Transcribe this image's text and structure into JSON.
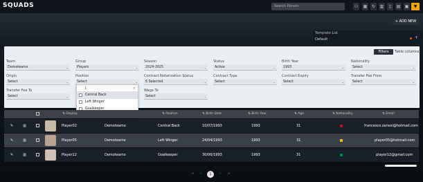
{
  "app": {
    "title": "SQUADS"
  },
  "search": {
    "placeholder": "Search Person"
  },
  "toolbar": {
    "add_new": "+ ADD NEW"
  },
  "template": {
    "label": "Template List",
    "value": "Default"
  },
  "filters": {
    "tabs": [
      "Filters",
      "Table columns"
    ],
    "fields": [
      {
        "label": "Team",
        "value": "Demoteamx"
      },
      {
        "label": "Group",
        "value": "Players"
      },
      {
        "label": "Season",
        "value": "2024-2025"
      },
      {
        "label": "Status",
        "value": "Active"
      },
      {
        "label": "Birth Year",
        "value": "1993"
      },
      {
        "label": "Nationality",
        "value": "Select"
      },
      {
        "label": "Origin",
        "value": "Select"
      },
      {
        "label": "Position",
        "value": "Select"
      },
      {
        "label": "Contract Notarization Status",
        "value": "6 Selected"
      },
      {
        "label": "Contract Type",
        "value": "Select"
      },
      {
        "label": "Contract Expiry",
        "value": "Select"
      },
      {
        "label": "Transfer Fee From",
        "value": "Select"
      },
      {
        "label": "Transfer Fee To",
        "value": "Select"
      },
      {
        "label": "Wage To",
        "value": "Select"
      }
    ],
    "dropdown": {
      "search_value": "l",
      "options": [
        "Central Back",
        "Left Winger",
        "Goalkeeper"
      ]
    }
  },
  "table": {
    "headers": [
      "Display",
      "Position",
      "Birth Date",
      "Birth Year",
      "Age",
      "Nationality",
      "Email"
    ],
    "rows": [
      {
        "display": "Player02",
        "team": "Demoteamx",
        "position": "Central Back",
        "birth_date": "10/07/1993",
        "birth_year": "1993",
        "age": "31",
        "email": "francesco.zanesi@hotmail.com",
        "flag_color": "#c8102e"
      },
      {
        "display": "Player05",
        "team": "Demoteams",
        "position": "Left Winger",
        "birth_date": "24/04/1993",
        "birth_year": "1993",
        "age": "31",
        "email": "player05@hotmail.com",
        "flag_color": "#f1bf00"
      },
      {
        "display": "Player12",
        "team": "Demoteamx",
        "position": "Goalkeeper",
        "birth_date": "30/06/1993",
        "birth_year": "1993",
        "age": "31",
        "email": "player12@gmail.com",
        "flag_color": "#009246"
      }
    ]
  },
  "pagination": {
    "current": "1"
  }
}
